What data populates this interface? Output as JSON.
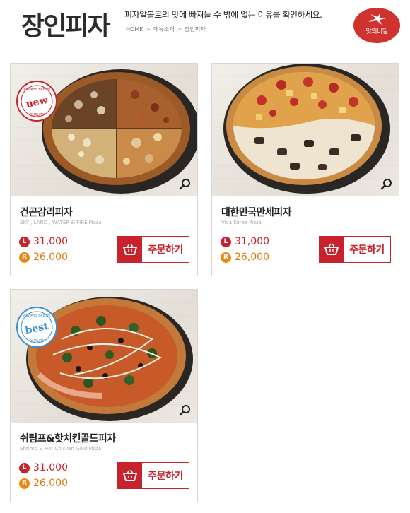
{
  "header": {
    "title": "장인피자",
    "description": "피자알볼로의 맛에 빠져들 수 밖에 없는 이유를 확인하세요.",
    "breadcrumb": [
      "HOME",
      "메뉴소개",
      "장인피자"
    ],
    "secret_button_label": "맛의비밀"
  },
  "products": [
    {
      "name": "건곤감리피자",
      "subtitle": "SKY , LAND , WATER & FIRE Pizza",
      "price_l": "31,000",
      "price_r": "26,000",
      "badge_l": "L",
      "badge_r": "R",
      "order_label": "주문하기",
      "stamp": "new",
      "stamp_top": "ALWAYS FRESH",
      "stamp_bottom": "QUALITY"
    },
    {
      "name": "대한민국만세피자",
      "subtitle": "Viva Korea Pizza",
      "price_l": "31,000",
      "price_r": "26,000",
      "badge_l": "L",
      "badge_r": "R",
      "order_label": "주문하기"
    },
    {
      "name": "쉬림프&핫치킨골드피자",
      "subtitle": "Shrimp & Hot Chicken Gold Pizza",
      "price_l": "31,000",
      "price_r": "26,000",
      "badge_l": "L",
      "badge_r": "R",
      "order_label": "주문하기",
      "stamp": "best",
      "stamp_top": "ALWAYS FRESH",
      "stamp_bottom": "QUALITY"
    }
  ],
  "colors": {
    "accent": "#c8232c",
    "price_l": "#c8232c",
    "price_r": "#e07a10",
    "secret_button": "#d0322f"
  },
  "icons": [
    "zoom-icon",
    "cart-icon",
    "star-burst-icon"
  ]
}
